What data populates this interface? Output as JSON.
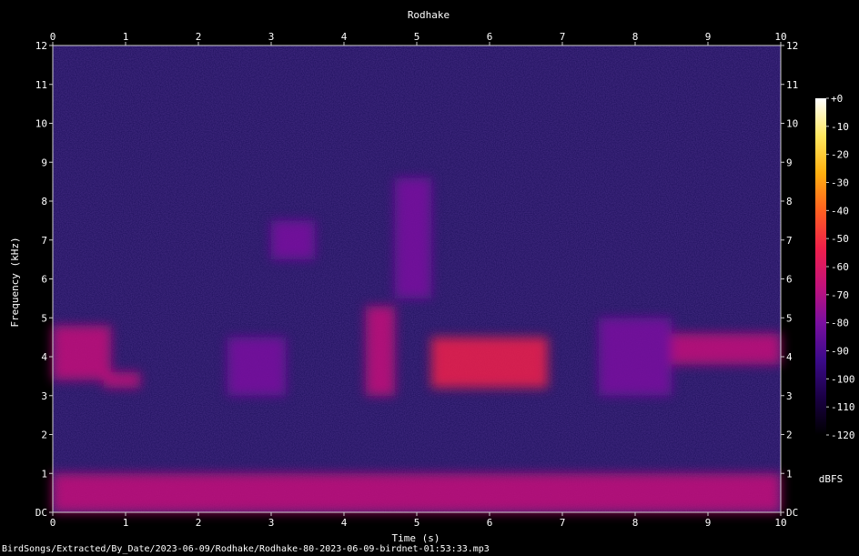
{
  "chart_data": {
    "type": "heatmap",
    "title": "Rodhake",
    "xlabel": "Time (s)",
    "ylabel": "Frequency (kHz)",
    "xlim": [
      0,
      10
    ],
    "ylim": [
      0,
      12
    ],
    "x_ticks": [
      "0",
      "1",
      "2",
      "3",
      "4",
      "5",
      "6",
      "7",
      "8",
      "9",
      "10"
    ],
    "y_ticks": [
      "DC",
      "1",
      "2",
      "3",
      "4",
      "5",
      "6",
      "7",
      "8",
      "9",
      "10",
      "11",
      "12"
    ],
    "colorbar": {
      "label": "dBFS",
      "range": [
        -120,
        0
      ],
      "ticks": [
        "+0",
        "-10",
        "-20",
        "-30",
        "-40",
        "-50",
        "-60",
        "-70",
        "-80",
        "-90",
        "-100",
        "-110",
        "-120"
      ],
      "colors": [
        "#000000",
        "#1a0044",
        "#3b0a8a",
        "#7a0fa0",
        "#c4127a",
        "#f0204a",
        "#ff6020",
        "#ffb010",
        "#ffe860",
        "#ffffff"
      ]
    },
    "background_level_dbfs": -95,
    "energy_regions": [
      {
        "t": [
          0.0,
          0.8
        ],
        "f": [
          3.4,
          4.8
        ],
        "level_dbfs": -62
      },
      {
        "t": [
          0.7,
          1.2
        ],
        "f": [
          3.2,
          3.6
        ],
        "level_dbfs": -65
      },
      {
        "t": [
          2.4,
          3.2
        ],
        "f": [
          3.0,
          4.5
        ],
        "level_dbfs": -78
      },
      {
        "t": [
          3.0,
          3.6
        ],
        "f": [
          6.5,
          7.5
        ],
        "level_dbfs": -75
      },
      {
        "t": [
          4.3,
          4.7
        ],
        "f": [
          3.0,
          5.3
        ],
        "level_dbfs": -72
      },
      {
        "t": [
          4.7,
          5.2
        ],
        "f": [
          5.5,
          8.6
        ],
        "level_dbfs": -76
      },
      {
        "t": [
          5.2,
          6.8
        ],
        "f": [
          3.2,
          4.5
        ],
        "level_dbfs": -60
      },
      {
        "t": [
          7.5,
          8.5
        ],
        "f": [
          3.0,
          5.0
        ],
        "level_dbfs": -80
      },
      {
        "t": [
          8.5,
          10.0
        ],
        "f": [
          3.8,
          4.6
        ],
        "level_dbfs": -70
      },
      {
        "t": [
          0.0,
          10.0
        ],
        "f": [
          0.0,
          1.0
        ],
        "level_dbfs": -72
      }
    ]
  },
  "footer_text": "BirdSongs/Extracted/By_Date/2023-06-09/Rodhake/Rodhake-80-2023-06-09-birdnet-01:53:33.mp3"
}
